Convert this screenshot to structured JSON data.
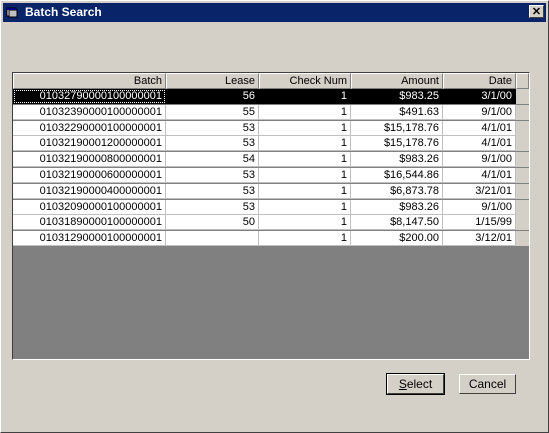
{
  "window": {
    "title": "Batch Search",
    "close_glyph": "✕",
    "titlebar_color": "#0a246a"
  },
  "grid": {
    "columns": [
      "Batch",
      "Lease",
      "Check Num",
      "Amount",
      "Date"
    ],
    "rows": [
      [
        "01032790000100000001",
        "56",
        "1",
        "$983.25",
        "3/1/00"
      ],
      [
        "01032390000100000001",
        "55",
        "1",
        "$491.63",
        "9/1/00"
      ],
      [
        "01032290000100000001",
        "53",
        "1",
        "$15,178.76",
        "4/1/01"
      ],
      [
        "01032190001200000001",
        "53",
        "1",
        "$15,178.76",
        "4/1/01"
      ],
      [
        "01032190000800000001",
        "54",
        "1",
        "$983.26",
        "9/1/00"
      ],
      [
        "01032190000600000001",
        "53",
        "1",
        "$16,544.86",
        "4/1/01"
      ],
      [
        "01032190000400000001",
        "53",
        "1",
        "$6,873.78",
        "3/21/01"
      ],
      [
        "01032090000100000001",
        "53",
        "1",
        "$983.26",
        "9/1/00"
      ],
      [
        "01031890000100000001",
        "50",
        "1",
        "$8,147.50",
        "1/15/99"
      ],
      [
        "01031290000100000001",
        "",
        "1",
        "$200.00",
        "3/12/01"
      ]
    ],
    "selected_row": 0
  },
  "buttons": {
    "select_ul": "S",
    "select_rest": "elect",
    "cancel": "Cancel"
  }
}
